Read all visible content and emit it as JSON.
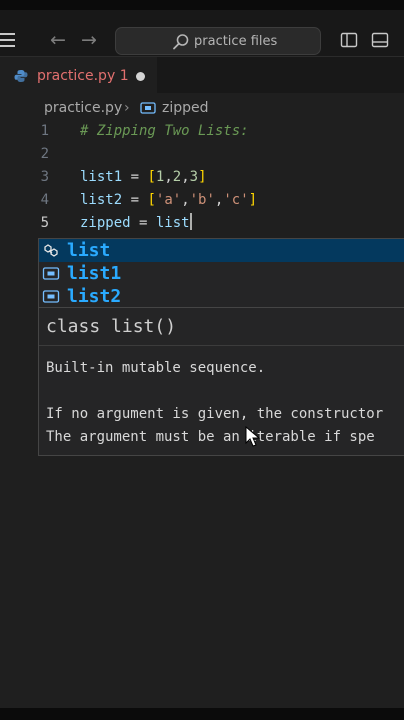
{
  "titlebar": {
    "search_text": "practice files",
    "back_icon": "arrow-left-icon",
    "forward_icon": "arrow-right-icon"
  },
  "tab": {
    "file_name": "practice.py",
    "problem_count": "1",
    "modified": true
  },
  "breadcrumb": {
    "file": "practice.py",
    "symbol": "zipped"
  },
  "code_lines": [
    {
      "number": "1",
      "text": "# Zipping Two Lists:"
    },
    {
      "number": "2",
      "text": ""
    },
    {
      "number": "3",
      "text": "list1 = [1,2,3]"
    },
    {
      "number": "4",
      "text": "list2 = ['a','b','c']"
    },
    {
      "number": "5",
      "text": "zipped = list"
    }
  ],
  "suggestions": [
    {
      "label": "list",
      "kind": "class",
      "selected": true
    },
    {
      "label": "list1",
      "kind": "variable",
      "selected": false
    },
    {
      "label": "list2",
      "kind": "variable",
      "selected": false
    }
  ],
  "details": {
    "signature": "class list()",
    "doc_lines": [
      "Built-in mutable sequence.",
      "",
      "If no argument is given, the constructor",
      "The argument must be an iterable if spe"
    ]
  },
  "colors": {
    "background": "#1f1f1f",
    "tab_error_text": "#e2706f",
    "selection": "#04395e",
    "match_highlight": "#2aaaff"
  }
}
